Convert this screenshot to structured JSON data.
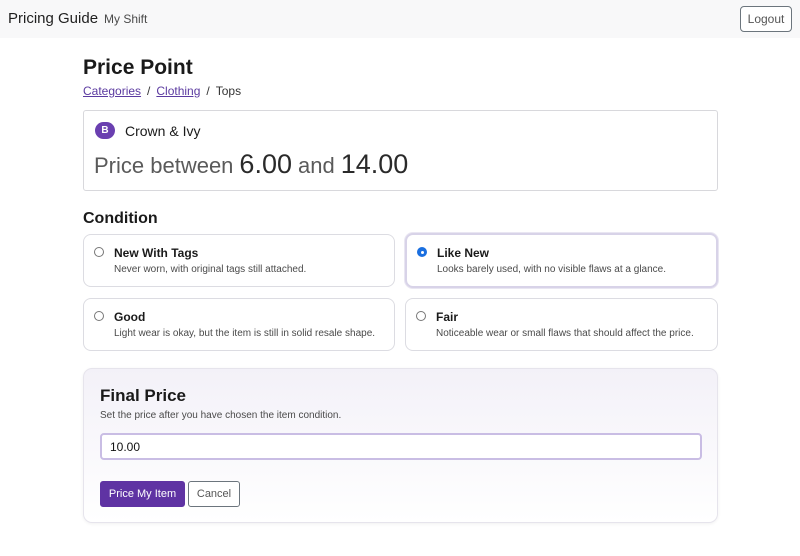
{
  "nav": {
    "brand": "Pricing Guide",
    "link": "My Shift",
    "logout_label": "Logout"
  },
  "page": {
    "title": "Price Point",
    "breadcrumb": {
      "items": [
        "Categories",
        "Clothing"
      ],
      "current": "Tops",
      "separator": "/"
    }
  },
  "brand_card": {
    "badge": "B",
    "name": "Crown & Ivy",
    "price_prefix": "Price between",
    "min": "6.00",
    "conjunction": "and",
    "max": "14.00"
  },
  "condition": {
    "heading": "Condition",
    "selected": "Like New",
    "options": [
      {
        "title": "New With Tags",
        "desc": "Never worn, with original tags still attached."
      },
      {
        "title": "Like New",
        "desc": "Looks barely used, with no visible flaws at a glance."
      },
      {
        "title": "Good",
        "desc": "Light wear is okay, but the item is still in solid resale shape."
      },
      {
        "title": "Fair",
        "desc": "Noticeable wear or small flaws that should affect the price."
      }
    ]
  },
  "final": {
    "title": "Final Price",
    "subtitle": "Set the price after you have chosen the item condition.",
    "value": "10.00",
    "submit_label": "Price My Item",
    "cancel_label": "Cancel"
  },
  "colors": {
    "accent": "#5f33a3",
    "badge": "#6a3fb0",
    "link": "#5b3aa0",
    "radio_selected": "#1a6fe0"
  }
}
